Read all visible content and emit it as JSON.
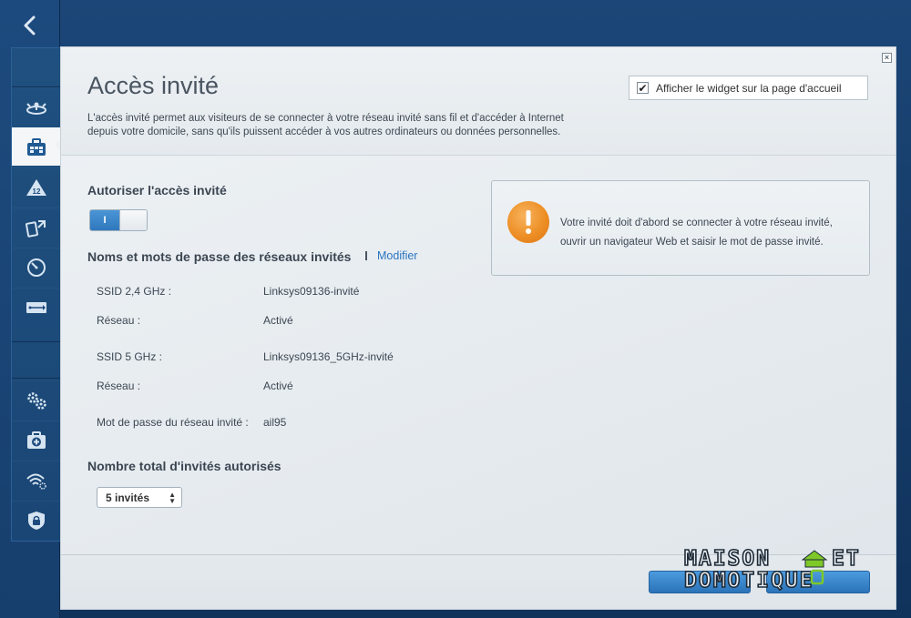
{
  "page": {
    "title": "Accès invité",
    "description_line1": "L'accès invité permet aux visiteurs de se connecter à votre réseau invité sans fil et d'accéder à Internet",
    "description_line2": "depuis votre domicile, sans qu'ils puissent accéder à vos autres ordinateurs ou données personnelles.",
    "widget_checkbox_label": "Afficher le widget sur la page d'accueil",
    "widget_checked": true
  },
  "allow": {
    "heading": "Autoriser l'accès invité",
    "toggle_label": "I",
    "toggle_on": true
  },
  "networks": {
    "heading": "Noms et mots de passe des réseaux invités",
    "modify_link": "Modifier",
    "rows": [
      {
        "label": "SSID 2,4 GHz :",
        "value": "Linksys09136-invité"
      },
      {
        "label": "Réseau :",
        "value": "Activé"
      },
      {
        "label": "SSID 5 GHz :",
        "value": "Linksys09136_5GHz-invité"
      },
      {
        "label": "Réseau :",
        "value": "Activé"
      },
      {
        "label": "Mot de passe du réseau invité :",
        "value": "ail95"
      }
    ]
  },
  "total": {
    "heading": "Nombre total d'invités autorisés",
    "selected": "5 invités"
  },
  "alert": {
    "icon": "exclamation-icon",
    "line1": "Votre invité doit d'abord se connecter à votre réseau invité,",
    "line2": "ouvrir un navigateur Web et saisir le mot de passe invité."
  },
  "watermark": {
    "line1": "MAISON",
    "line1b": "ET",
    "line2": "DOMOTIQUE"
  },
  "colors": {
    "accent": "#2a74c0",
    "sidebar": "#1d4a7e",
    "alert": "#ec8c22",
    "watermark_green": "#7ec828"
  },
  "sidebar_icons": [
    "router-icon",
    "guest-access-icon",
    "parental-control-icon",
    "media-priority-icon",
    "speed-test-icon",
    "usb-storage-icon",
    "settings-icon",
    "troubleshooting-icon",
    "wireless-icon",
    "security-icon"
  ]
}
